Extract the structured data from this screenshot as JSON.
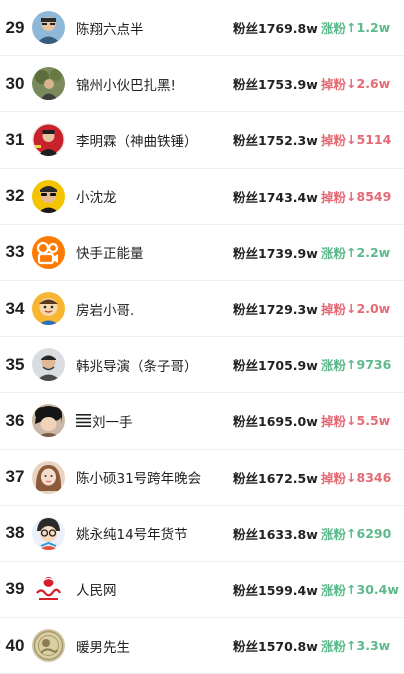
{
  "colors": {
    "up": "#5cb98a",
    "down": "#e46a74"
  },
  "rows": [
    {
      "rank": "29",
      "name": "陈翔六点半",
      "fans": "粉丝1769.8w",
      "change_label": "涨粉",
      "arrow": "↑",
      "change_value": "1.2w",
      "direction": "up",
      "avatar_icon": "avatar-man-glasses-icon"
    },
    {
      "rank": "30",
      "name": "锦州小伙巴扎黑!",
      "fans": "粉丝1753.9w",
      "change_label": "掉粉",
      "arrow": "↓",
      "change_value": "2.6w",
      "direction": "down",
      "avatar_icon": "avatar-outdoor-icon"
    },
    {
      "rank": "31",
      "name": "李明霖（神曲铁锤）",
      "fans": "粉丝1752.3w",
      "change_label": "掉粉",
      "arrow": "↓",
      "change_value": "5114",
      "direction": "down",
      "avatar_icon": "avatar-red-badge-icon"
    },
    {
      "rank": "32",
      "name": "小沈龙",
      "fans": "粉丝1743.4w",
      "change_label": "掉粉",
      "arrow": "↓",
      "change_value": "8549",
      "direction": "down",
      "avatar_icon": "avatar-yellow-glasses-icon"
    },
    {
      "rank": "33",
      "name": "快手正能量",
      "fans": "粉丝1739.9w",
      "change_label": "涨粉",
      "arrow": "↑",
      "change_value": "2.2w",
      "direction": "up",
      "avatar_icon": "kuaishou-logo-icon"
    },
    {
      "rank": "34",
      "name": "房岩小哥.",
      "fans": "粉丝1729.3w",
      "change_label": "掉粉",
      "arrow": "↓",
      "change_value": "2.0w",
      "direction": "down",
      "avatar_icon": "avatar-cartoon-yellow-icon"
    },
    {
      "rank": "35",
      "name": "韩兆导演（条子哥）",
      "fans": "粉丝1705.9w",
      "change_label": "涨粉",
      "arrow": "↑",
      "change_value": "9736",
      "direction": "up",
      "avatar_icon": "avatar-man-portrait-icon"
    },
    {
      "rank": "36",
      "name": "刘一手",
      "fans": "粉丝1695.0w",
      "change_label": "掉粉",
      "arrow": "↓",
      "change_value": "5.5w",
      "direction": "down",
      "avatar_icon": "avatar-dark-hair-icon",
      "name_icon": "lines-icon"
    },
    {
      "rank": "37",
      "name": "陈小硕31号跨年晚会",
      "fans": "粉丝1672.5w",
      "change_label": "掉粉",
      "arrow": "↓",
      "change_value": "8346",
      "direction": "down",
      "avatar_icon": "avatar-woman-icon"
    },
    {
      "rank": "38",
      "name": "姚永纯14号年货节",
      "fans": "粉丝1633.8w",
      "change_label": "涨粉",
      "arrow": "↑",
      "change_value": "6290",
      "direction": "up",
      "avatar_icon": "avatar-cartoon-glasses-icon"
    },
    {
      "rank": "39",
      "name": "人民网",
      "fans": "粉丝1599.4w",
      "change_label": "涨粉",
      "arrow": "↑",
      "change_value": "30.4w",
      "direction": "up",
      "avatar_icon": "people-daily-logo-icon"
    },
    {
      "rank": "40",
      "name": "暖男先生",
      "fans": "粉丝1570.8w",
      "change_label": "涨粉",
      "arrow": "↑",
      "change_value": "3.3w",
      "direction": "up",
      "avatar_icon": "avatar-coin-icon"
    }
  ]
}
